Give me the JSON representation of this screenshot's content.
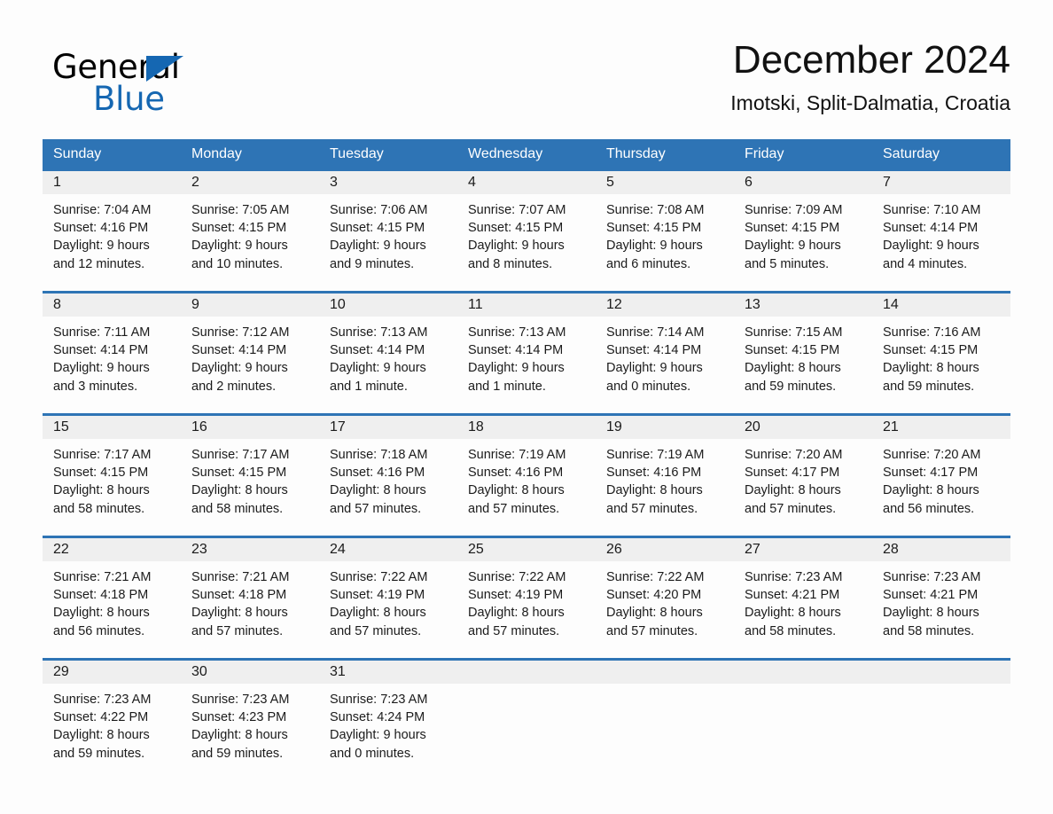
{
  "brand": {
    "name_dark": "General",
    "name_blue": "Blue",
    "logo_icon": "triangle-icon",
    "accent_color": "#1567b2"
  },
  "header": {
    "title": "December 2024",
    "subtitle": "Imotski, Split-Dalmatia, Croatia"
  },
  "theme": {
    "header_blue": "#2e74b5",
    "day_band_gray": "#efefef",
    "page_background": "#fdfdfd",
    "text_color": "#1b1b1b"
  },
  "calendar": {
    "weekday_headers": [
      "Sunday",
      "Monday",
      "Tuesday",
      "Wednesday",
      "Thursday",
      "Friday",
      "Saturday"
    ],
    "weeks": [
      {
        "daynums": [
          "1",
          "2",
          "3",
          "4",
          "5",
          "6",
          "7"
        ],
        "cells": [
          {
            "sunrise": "Sunrise: 7:04 AM",
            "sunset": "Sunset: 4:16 PM",
            "daylight1": "Daylight: 9 hours",
            "daylight2": "and 12 minutes."
          },
          {
            "sunrise": "Sunrise: 7:05 AM",
            "sunset": "Sunset: 4:15 PM",
            "daylight1": "Daylight: 9 hours",
            "daylight2": "and 10 minutes."
          },
          {
            "sunrise": "Sunrise: 7:06 AM",
            "sunset": "Sunset: 4:15 PM",
            "daylight1": "Daylight: 9 hours",
            "daylight2": "and 9 minutes."
          },
          {
            "sunrise": "Sunrise: 7:07 AM",
            "sunset": "Sunset: 4:15 PM",
            "daylight1": "Daylight: 9 hours",
            "daylight2": "and 8 minutes."
          },
          {
            "sunrise": "Sunrise: 7:08 AM",
            "sunset": "Sunset: 4:15 PM",
            "daylight1": "Daylight: 9 hours",
            "daylight2": "and 6 minutes."
          },
          {
            "sunrise": "Sunrise: 7:09 AM",
            "sunset": "Sunset: 4:15 PM",
            "daylight1": "Daylight: 9 hours",
            "daylight2": "and 5 minutes."
          },
          {
            "sunrise": "Sunrise: 7:10 AM",
            "sunset": "Sunset: 4:14 PM",
            "daylight1": "Daylight: 9 hours",
            "daylight2": "and 4 minutes."
          }
        ]
      },
      {
        "daynums": [
          "8",
          "9",
          "10",
          "11",
          "12",
          "13",
          "14"
        ],
        "cells": [
          {
            "sunrise": "Sunrise: 7:11 AM",
            "sunset": "Sunset: 4:14 PM",
            "daylight1": "Daylight: 9 hours",
            "daylight2": "and 3 minutes."
          },
          {
            "sunrise": "Sunrise: 7:12 AM",
            "sunset": "Sunset: 4:14 PM",
            "daylight1": "Daylight: 9 hours",
            "daylight2": "and 2 minutes."
          },
          {
            "sunrise": "Sunrise: 7:13 AM",
            "sunset": "Sunset: 4:14 PM",
            "daylight1": "Daylight: 9 hours",
            "daylight2": "and 1 minute."
          },
          {
            "sunrise": "Sunrise: 7:13 AM",
            "sunset": "Sunset: 4:14 PM",
            "daylight1": "Daylight: 9 hours",
            "daylight2": "and 1 minute."
          },
          {
            "sunrise": "Sunrise: 7:14 AM",
            "sunset": "Sunset: 4:14 PM",
            "daylight1": "Daylight: 9 hours",
            "daylight2": "and 0 minutes."
          },
          {
            "sunrise": "Sunrise: 7:15 AM",
            "sunset": "Sunset: 4:15 PM",
            "daylight1": "Daylight: 8 hours",
            "daylight2": "and 59 minutes."
          },
          {
            "sunrise": "Sunrise: 7:16 AM",
            "sunset": "Sunset: 4:15 PM",
            "daylight1": "Daylight: 8 hours",
            "daylight2": "and 59 minutes."
          }
        ]
      },
      {
        "daynums": [
          "15",
          "16",
          "17",
          "18",
          "19",
          "20",
          "21"
        ],
        "cells": [
          {
            "sunrise": "Sunrise: 7:17 AM",
            "sunset": "Sunset: 4:15 PM",
            "daylight1": "Daylight: 8 hours",
            "daylight2": "and 58 minutes."
          },
          {
            "sunrise": "Sunrise: 7:17 AM",
            "sunset": "Sunset: 4:15 PM",
            "daylight1": "Daylight: 8 hours",
            "daylight2": "and 58 minutes."
          },
          {
            "sunrise": "Sunrise: 7:18 AM",
            "sunset": "Sunset: 4:16 PM",
            "daylight1": "Daylight: 8 hours",
            "daylight2": "and 57 minutes."
          },
          {
            "sunrise": "Sunrise: 7:19 AM",
            "sunset": "Sunset: 4:16 PM",
            "daylight1": "Daylight: 8 hours",
            "daylight2": "and 57 minutes."
          },
          {
            "sunrise": "Sunrise: 7:19 AM",
            "sunset": "Sunset: 4:16 PM",
            "daylight1": "Daylight: 8 hours",
            "daylight2": "and 57 minutes."
          },
          {
            "sunrise": "Sunrise: 7:20 AM",
            "sunset": "Sunset: 4:17 PM",
            "daylight1": "Daylight: 8 hours",
            "daylight2": "and 57 minutes."
          },
          {
            "sunrise": "Sunrise: 7:20 AM",
            "sunset": "Sunset: 4:17 PM",
            "daylight1": "Daylight: 8 hours",
            "daylight2": "and 56 minutes."
          }
        ]
      },
      {
        "daynums": [
          "22",
          "23",
          "24",
          "25",
          "26",
          "27",
          "28"
        ],
        "cells": [
          {
            "sunrise": "Sunrise: 7:21 AM",
            "sunset": "Sunset: 4:18 PM",
            "daylight1": "Daylight: 8 hours",
            "daylight2": "and 56 minutes."
          },
          {
            "sunrise": "Sunrise: 7:21 AM",
            "sunset": "Sunset: 4:18 PM",
            "daylight1": "Daylight: 8 hours",
            "daylight2": "and 57 minutes."
          },
          {
            "sunrise": "Sunrise: 7:22 AM",
            "sunset": "Sunset: 4:19 PM",
            "daylight1": "Daylight: 8 hours",
            "daylight2": "and 57 minutes."
          },
          {
            "sunrise": "Sunrise: 7:22 AM",
            "sunset": "Sunset: 4:19 PM",
            "daylight1": "Daylight: 8 hours",
            "daylight2": "and 57 minutes."
          },
          {
            "sunrise": "Sunrise: 7:22 AM",
            "sunset": "Sunset: 4:20 PM",
            "daylight1": "Daylight: 8 hours",
            "daylight2": "and 57 minutes."
          },
          {
            "sunrise": "Sunrise: 7:23 AM",
            "sunset": "Sunset: 4:21 PM",
            "daylight1": "Daylight: 8 hours",
            "daylight2": "and 58 minutes."
          },
          {
            "sunrise": "Sunrise: 7:23 AM",
            "sunset": "Sunset: 4:21 PM",
            "daylight1": "Daylight: 8 hours",
            "daylight2": "and 58 minutes."
          }
        ]
      },
      {
        "daynums": [
          "29",
          "30",
          "31",
          "",
          "",
          "",
          ""
        ],
        "cells": [
          {
            "sunrise": "Sunrise: 7:23 AM",
            "sunset": "Sunset: 4:22 PM",
            "daylight1": "Daylight: 8 hours",
            "daylight2": "and 59 minutes."
          },
          {
            "sunrise": "Sunrise: 7:23 AM",
            "sunset": "Sunset: 4:23 PM",
            "daylight1": "Daylight: 8 hours",
            "daylight2": "and 59 minutes."
          },
          {
            "sunrise": "Sunrise: 7:23 AM",
            "sunset": "Sunset: 4:24 PM",
            "daylight1": "Daylight: 9 hours",
            "daylight2": "and 0 minutes."
          },
          {
            "sunrise": "",
            "sunset": "",
            "daylight1": "",
            "daylight2": ""
          },
          {
            "sunrise": "",
            "sunset": "",
            "daylight1": "",
            "daylight2": ""
          },
          {
            "sunrise": "",
            "sunset": "",
            "daylight1": "",
            "daylight2": ""
          },
          {
            "sunrise": "",
            "sunset": "",
            "daylight1": "",
            "daylight2": ""
          }
        ]
      }
    ]
  }
}
